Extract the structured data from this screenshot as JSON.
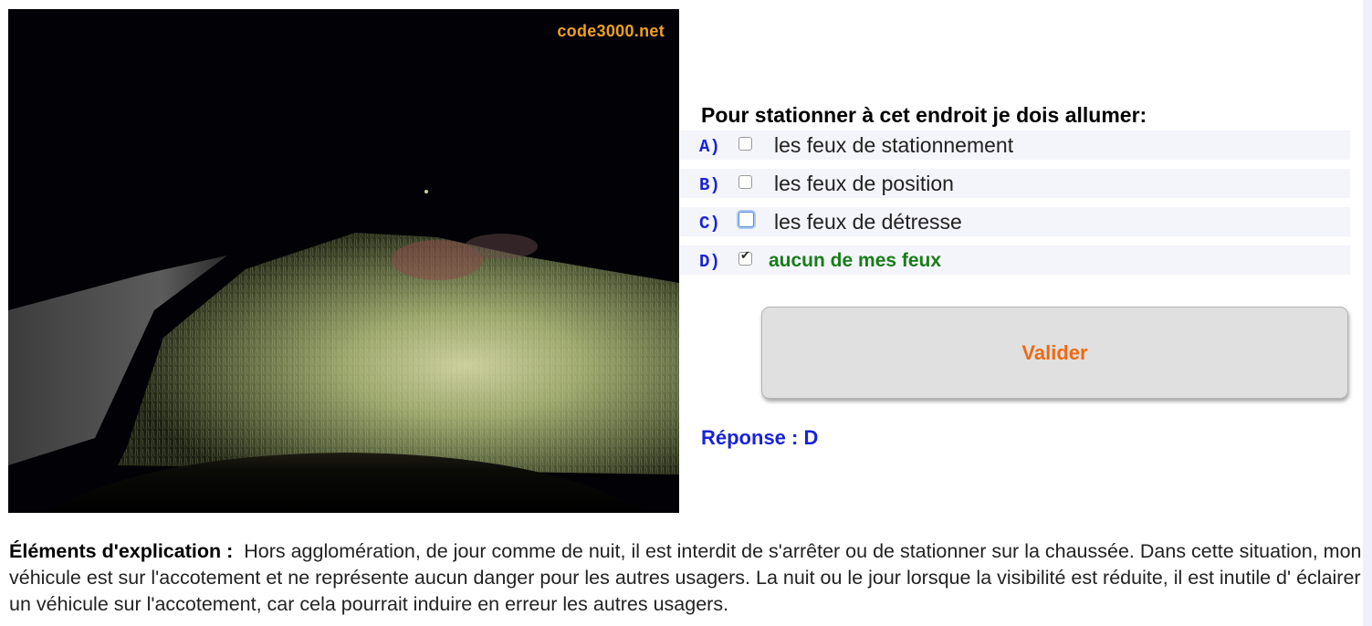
{
  "photo": {
    "watermark": "code3000.net"
  },
  "question": {
    "text": "Pour stationner à cet endroit je dois allumer:"
  },
  "options": [
    {
      "letter": "A)",
      "label": "les feux de stationnement",
      "checked": false
    },
    {
      "letter": "B)",
      "label": "les feux de position",
      "checked": false
    },
    {
      "letter": "C)",
      "label": "les feux de détresse",
      "checked": false
    },
    {
      "letter": "D)",
      "label": "aucun de mes feux",
      "checked": true
    }
  ],
  "validate": {
    "label": "Valider"
  },
  "answer": {
    "text": "Réponse : D"
  },
  "explanation": {
    "lead": "Éléments d'explication :",
    "body": "Hors agglomération, de jour comme de nuit, il est interdit de s'arrêter ou de stationner sur la chaussée. Dans cette situation, mon véhicule est sur l'accotement et ne représente aucun danger pour les autres usagers. La nuit ou le jour lorsque la visibilité est réduite, il est inutile d' éclairer un véhicule sur l'accotement, car cela pourrait induire en erreur les autres usagers."
  },
  "colors": {
    "question_letter": "#1a23d8",
    "correct_option": "#197c19",
    "validate_text": "#ee6a14",
    "answer": "#1a23d8",
    "watermark": "#f0a020"
  }
}
